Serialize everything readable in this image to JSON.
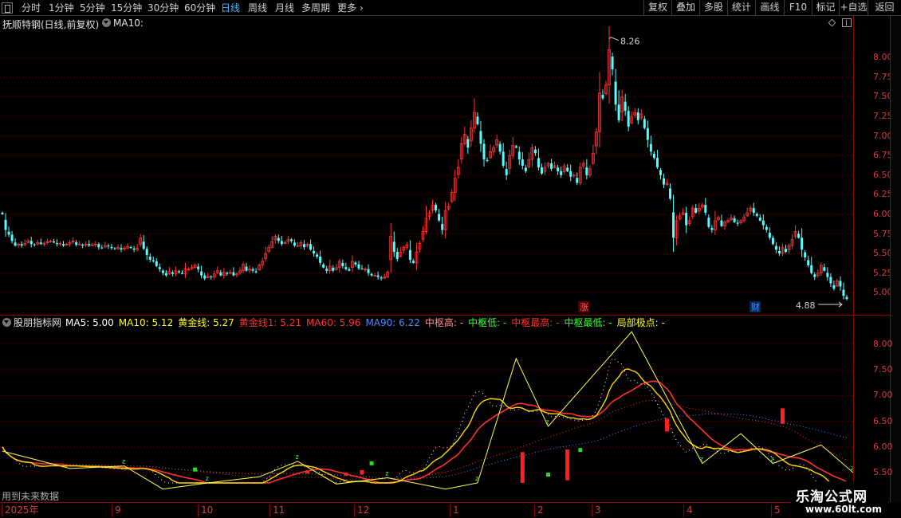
{
  "toolbar": {
    "periods": [
      {
        "label": "分时",
        "active": false
      },
      {
        "label": "1分钟",
        "active": false
      },
      {
        "label": "5分钟",
        "active": false
      },
      {
        "label": "15分钟",
        "active": false
      },
      {
        "label": "30分钟",
        "active": false
      },
      {
        "label": "60分钟",
        "active": false
      },
      {
        "label": "日线",
        "active": true
      },
      {
        "label": "周线",
        "active": false
      },
      {
        "label": "月线",
        "active": false
      },
      {
        "label": "多周期",
        "active": false
      },
      {
        "label": "更多 ›",
        "active": false
      }
    ],
    "actions": [
      "复权",
      "叠加",
      "多股",
      "统计",
      "画线",
      "F10",
      "标记",
      "+自选",
      "返回"
    ]
  },
  "main_chart": {
    "title": "抚顺特钢(日线,前复权)",
    "ma_label": "MA10:",
    "high_label": "8.26",
    "low_label": "4.88",
    "marker_zhang": "涨",
    "marker_cai": "财",
    "y_ticks": [
      "8.00",
      "7.75",
      "7.50",
      "7.25",
      "7.00",
      "6.75",
      "6.50",
      "6.25",
      "6.00",
      "5.75",
      "5.50",
      "5.25",
      "5.00"
    ]
  },
  "indicator": {
    "name": "股朋指标网",
    "values": [
      {
        "label": "MA5: 5.00",
        "color": "#ffffff"
      },
      {
        "label": "MA10: 5.12",
        "color": "#ffff00"
      },
      {
        "label": "黄金线: 5.27",
        "color": "#ffff00"
      },
      {
        "label": "黄金线1: 5.21",
        "color": "#ff3030"
      },
      {
        "label": "MA60: 5.96",
        "color": "#ff3030"
      },
      {
        "label": "MA90: 6.22",
        "color": "#4d8cff"
      },
      {
        "label": "中枢高: -",
        "color": "#ff9090"
      },
      {
        "label": "中枢低: -",
        "color": "#30ff30"
      },
      {
        "label": "中枢最高: -",
        "color": "#ff3030"
      },
      {
        "label": "中枢最低: -",
        "color": "#30ff30"
      },
      {
        "label": "局部极点: -",
        "color": "#ffff00"
      }
    ],
    "y_ticks": [
      "8.00",
      "7.50",
      "7.00",
      "6.50",
      "6.00",
      "5.50"
    ],
    "future_note": "用到未来数据"
  },
  "date_axis": [
    "2025年",
    "9",
    "10",
    "11",
    "12",
    "1",
    "2",
    "3",
    "4",
    "5"
  ],
  "watermark": {
    "title": "乐淘公式网",
    "url": "www.60lt.com"
  },
  "colors": {
    "up": "#ff3232",
    "down": "#54ffff",
    "grid": "#6b0000",
    "axis_text": "#d83b3b"
  },
  "chart_data": {
    "type": "candlestick",
    "title": "抚顺特钢(日线,前复权)",
    "ylim": [
      4.85,
      8.45
    ],
    "x_months": [
      "2025年",
      "9",
      "10",
      "11",
      "12",
      "1",
      "2",
      "3",
      "4",
      "5"
    ],
    "closes": [
      6.0,
      5.8,
      5.74,
      5.66,
      5.6,
      5.62,
      5.6,
      5.63,
      5.66,
      5.62,
      5.61,
      5.64,
      5.62,
      5.63,
      5.65,
      5.66,
      5.64,
      5.62,
      5.63,
      5.6,
      5.62,
      5.64,
      5.66,
      5.61,
      5.62,
      5.6,
      5.62,
      5.6,
      5.61,
      5.62,
      5.58,
      5.57,
      5.6,
      5.59,
      5.57,
      5.56,
      5.58,
      5.55,
      5.57,
      5.59,
      5.57,
      5.55,
      5.57,
      5.7,
      5.56,
      5.48,
      5.42,
      5.4,
      5.34,
      5.3,
      5.25,
      5.22,
      5.27,
      5.24,
      5.28,
      5.26,
      5.24,
      5.3,
      5.3,
      5.32,
      5.35,
      5.3,
      5.22,
      5.18,
      5.21,
      5.2,
      5.24,
      5.28,
      5.22,
      5.26,
      5.24,
      5.26,
      5.22,
      5.24,
      5.28,
      5.36,
      5.28,
      5.3,
      5.28,
      5.26,
      5.35,
      5.4,
      5.5,
      5.58,
      5.65,
      5.72,
      5.66,
      5.62,
      5.64,
      5.68,
      5.66,
      5.6,
      5.6,
      5.64,
      5.58,
      5.62,
      5.55,
      5.5,
      5.46,
      5.38,
      5.32,
      5.28,
      5.34,
      5.28,
      5.32,
      5.4,
      5.34,
      5.3,
      5.28,
      5.4,
      5.36,
      5.31,
      5.3,
      5.3,
      5.25,
      5.22,
      5.22,
      5.2,
      5.18,
      5.2,
      5.26,
      5.72,
      5.52,
      5.43,
      5.52,
      5.58,
      5.61,
      5.42,
      5.38,
      5.52,
      5.63,
      5.78,
      5.95,
      6.02,
      6.12,
      6.05,
      5.92,
      5.8,
      6.05,
      6.1,
      6.28,
      6.46,
      6.6,
      6.9,
      7.02,
      6.85,
      7.1,
      7.3,
      7.15,
      6.9,
      6.7,
      6.68,
      6.8,
      6.85,
      6.95,
      6.8,
      6.62,
      6.5,
      6.75,
      6.88,
      6.85,
      6.7,
      6.62,
      6.55,
      6.7,
      6.85,
      6.78,
      6.6,
      6.52,
      6.6,
      6.65,
      6.58,
      6.62,
      6.55,
      6.5,
      6.62,
      6.55,
      6.48,
      6.5,
      6.4,
      6.6,
      6.65,
      6.5,
      6.58,
      6.78,
      7.05,
      7.55,
      7.48,
      7.65,
      8.1,
      7.85,
      7.4,
      7.2,
      7.5,
      7.32,
      7.12,
      7.25,
      7.3,
      7.2,
      7.28,
      7.1,
      6.95,
      6.8,
      6.72,
      6.6,
      6.5,
      6.38,
      6.4,
      6.2,
      5.7,
      5.92,
      5.98,
      6.02,
      5.86,
      5.92,
      6.08,
      6.02,
      6.08,
      6.12,
      6.02,
      5.84,
      5.8,
      5.92,
      5.96,
      5.85,
      5.9,
      5.92,
      5.95,
      5.9,
      5.88,
      5.92,
      5.96,
      6.02,
      6.08,
      6.02,
      5.98,
      5.92,
      5.86,
      5.8,
      5.7,
      5.62,
      5.55,
      5.5,
      5.58,
      5.52,
      5.6,
      5.68,
      5.78,
      5.7,
      5.55,
      5.45,
      5.35,
      5.25,
      5.2,
      5.25,
      5.35,
      5.28,
      5.2,
      5.12,
      5.05,
      5.15,
      5.08,
      4.96,
      4.92
    ],
    "high_point": 8.26,
    "low_point": 4.88,
    "indicator": {
      "ylim": [
        5.3,
        8.4
      ],
      "zigzag": [
        [
          0,
          5.92
        ],
        [
          21,
          5.58
        ],
        [
          38,
          5.63
        ],
        [
          50,
          5.18
        ],
        [
          64,
          5.3
        ],
        [
          80,
          5.42
        ],
        [
          92,
          5.72
        ],
        [
          104,
          5.28
        ],
        [
          120,
          5.4
        ],
        [
          138,
          5.18
        ],
        [
          148,
          5.3
        ],
        [
          160,
          7.72
        ],
        [
          170,
          6.4
        ],
        [
          196,
          8.24
        ],
        [
          218,
          5.68
        ],
        [
          230,
          6.26
        ],
        [
          240,
          5.68
        ],
        [
          255,
          6.04
        ],
        [
          265,
          5.5
        ],
        [
          275,
          5.75
        ],
        [
          285,
          5.3
        ]
      ]
    }
  }
}
